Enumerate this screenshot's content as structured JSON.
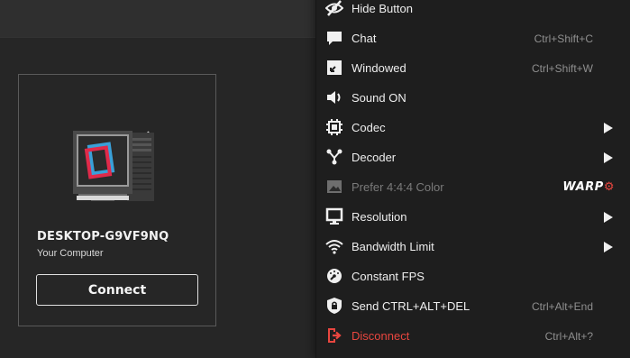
{
  "card": {
    "computer_name": "DESKTOP-G9VF9NQ",
    "subtitle": "Your Computer",
    "connect_label": "Connect"
  },
  "menu": {
    "items": [
      {
        "label": "Hide Button",
        "icon": "eye-slash-icon"
      },
      {
        "label": "Chat",
        "shortcut": "Ctrl+Shift+C",
        "icon": "chat-icon"
      },
      {
        "label": "Windowed",
        "shortcut": "Ctrl+Shift+W",
        "icon": "windowed-icon"
      },
      {
        "label": "Sound ON",
        "icon": "speaker-icon"
      },
      {
        "label": "Codec",
        "icon": "chip-icon",
        "submenu": true
      },
      {
        "label": "Decoder",
        "icon": "decoder-icon",
        "submenu": true
      },
      {
        "label": "Prefer 4:4:4 Color",
        "icon": "image-icon",
        "disabled": true,
        "badge": "WARP",
        "badge_accent": "⚙"
      },
      {
        "label": "Resolution",
        "icon": "monitor-icon",
        "submenu": true
      },
      {
        "label": "Bandwidth Limit",
        "icon": "wifi-icon",
        "submenu": true
      },
      {
        "label": "Constant FPS",
        "icon": "gauge-icon"
      },
      {
        "label": "Send CTRL+ALT+DEL",
        "shortcut": "Ctrl+Alt+End",
        "icon": "shield-lock-icon"
      },
      {
        "label": "Disconnect",
        "shortcut": "Ctrl+Alt+?",
        "icon": "disconnect-icon",
        "danger": true
      }
    ]
  },
  "colors": {
    "background": "#262626",
    "menu_background": "#1e1e1e",
    "accent_red": "#e9463f",
    "muted_text": "#8f8f8f"
  }
}
